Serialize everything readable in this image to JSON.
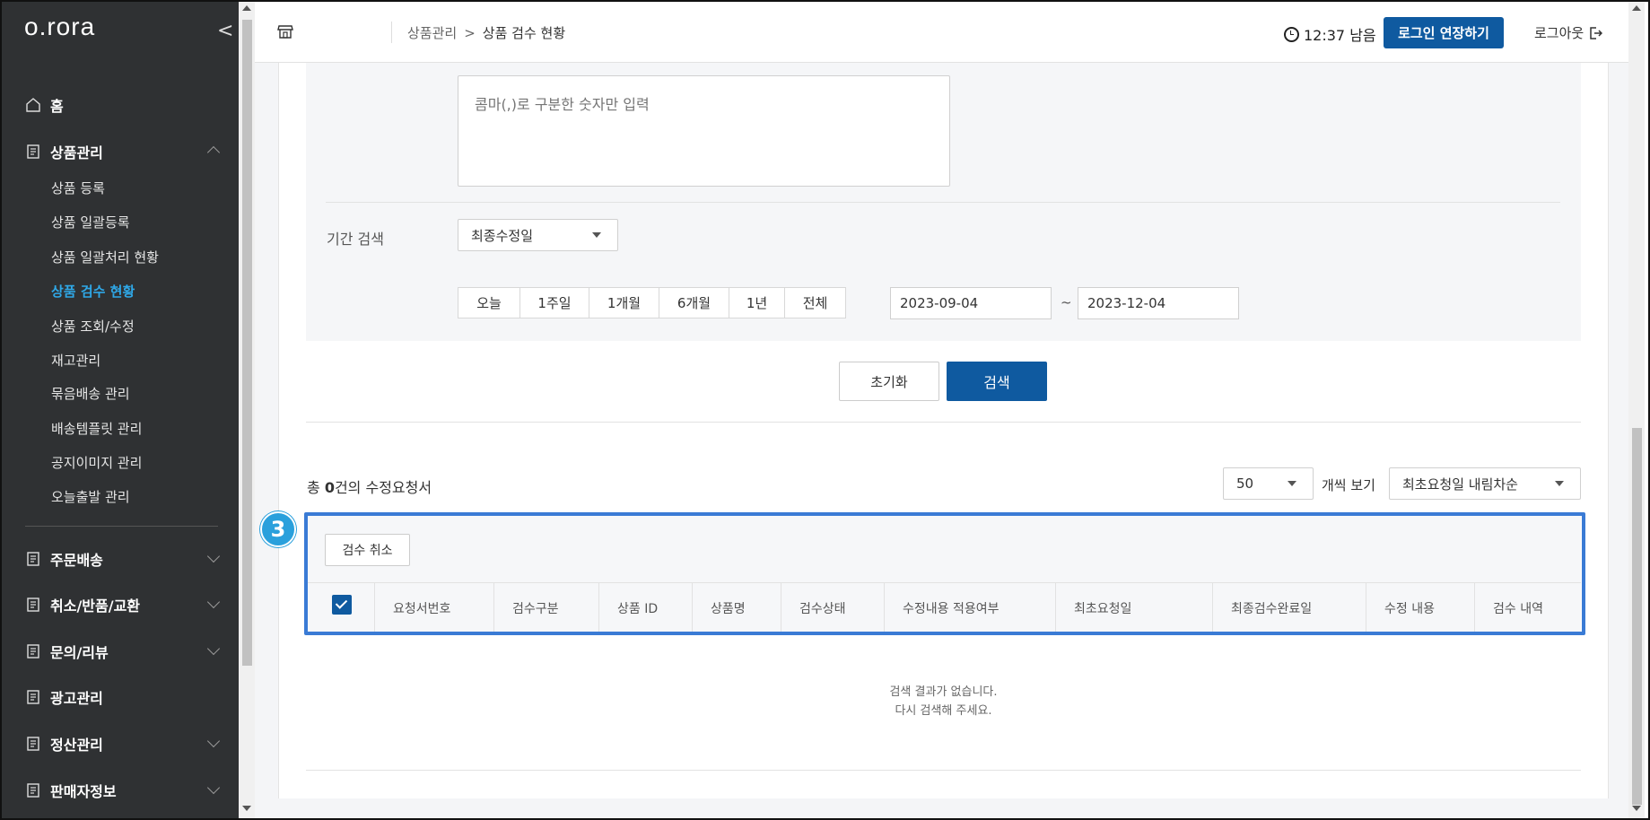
{
  "app": {
    "logo": "o.rora"
  },
  "sidebar": {
    "home": "홈",
    "product_mgmt": "상품관리",
    "sub_items": [
      "상품 등록",
      "상품 일괄등록",
      "상품 일괄처리 현황",
      "상품 검수 현황",
      "상품 조회/수정",
      "재고관리",
      "묶음배송 관리",
      "배송템플릿 관리",
      "공지이미지 관리",
      "오늘출발 관리"
    ],
    "active_index": 3,
    "sections": [
      "주문배송",
      "취소/반품/교환",
      "문의/리뷰",
      "광고관리",
      "정산관리",
      "판매자정보"
    ]
  },
  "header": {
    "breadcrumb_parent": "상품관리",
    "breadcrumb_sep": ">",
    "breadcrumb_current": "상품 검수 현황",
    "timer": "12:37 남음",
    "extend_label": "로그인 연장하기",
    "logout_label": "로그아웃"
  },
  "filter": {
    "textarea_placeholder": "콤마(,)로 구분한 숫자만 입력",
    "period_label": "기간 검색",
    "date_type": "최종수정일",
    "period_buttons": [
      "오늘",
      "1주일",
      "1개월",
      "6개월",
      "1년",
      "전체"
    ],
    "date_from": "2023-09-04",
    "date_sep": "~",
    "date_to": "2023-12-04",
    "reset_label": "초기화",
    "search_label": "검색"
  },
  "results": {
    "total_prefix": "총 ",
    "total_count": "0",
    "total_suffix": "건의 수정요청서",
    "page_size": "50",
    "page_size_suffix": "개씩 보기",
    "sort": "최초요청일 내림차순",
    "badge": "3",
    "cancel_inspection_label": "검수 취소",
    "columns": [
      "요청서번호",
      "검수구분",
      "상품 ID",
      "상품명",
      "검수상태",
      "수정내용 적용여부",
      "최초요청일",
      "최종검수완료일",
      "수정 내용",
      "검수 내역"
    ],
    "empty_line1": "검색 결과가 없습니다.",
    "empty_line2": "다시 검색해 주세요."
  },
  "colors": {
    "accent": "#0f5aa0",
    "active_nav": "#2fa8e8",
    "highlight_border": "#3a7bd5",
    "badge": "#2aa0dc"
  }
}
